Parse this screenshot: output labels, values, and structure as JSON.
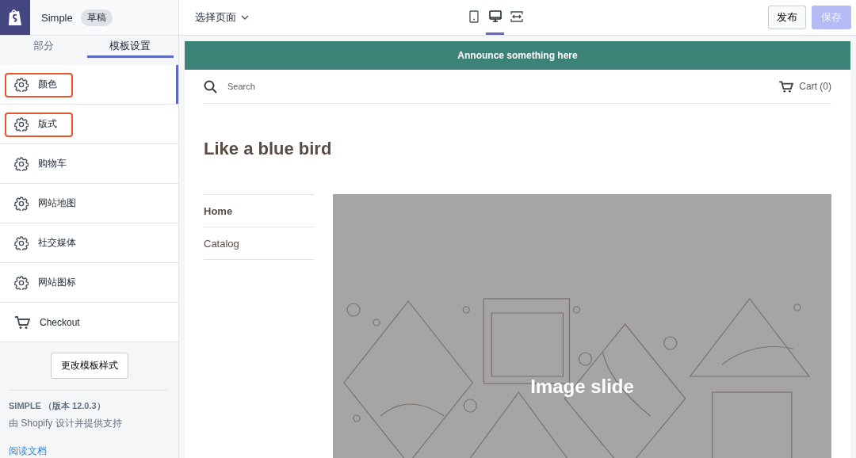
{
  "sidebar": {
    "theme_name": "Simple",
    "badge": "草稿",
    "tabs": [
      {
        "label": "部分",
        "selected": false
      },
      {
        "label": "模板设置",
        "selected": true
      }
    ],
    "items": [
      {
        "label": "颜色",
        "kind": "gear",
        "selected": true,
        "highlighted": true
      },
      {
        "label": "版式",
        "kind": "gear",
        "selected": false,
        "highlighted": true
      },
      {
        "label": "购物车",
        "kind": "gear",
        "selected": false,
        "highlighted": false
      },
      {
        "label": "网站地图",
        "kind": "gear",
        "selected": false,
        "highlighted": false
      },
      {
        "label": "社交媒体",
        "kind": "gear",
        "selected": false,
        "highlighted": false
      },
      {
        "label": "网站图标",
        "kind": "gear",
        "selected": false,
        "highlighted": false
      },
      {
        "label": "Checkout",
        "kind": "cart",
        "selected": false,
        "highlighted": false
      }
    ],
    "change_theme_button": "更改模板样式",
    "theme_info": "SIMPLE （版本 12.0.3）",
    "author": "由 Shopify 设计并提供支持",
    "docs_link": "阅读文档"
  },
  "topbar": {
    "page_select": "选择页面",
    "devices": [
      {
        "kind": "mobile",
        "selected": false
      },
      {
        "kind": "desktop",
        "selected": true
      },
      {
        "kind": "fullscreen",
        "selected": false
      }
    ],
    "publish_button": "发布",
    "save_button": {
      "label": "保存",
      "disabled": true
    }
  },
  "preview": {
    "announcement": "Announce something here",
    "search": "Search",
    "cart": "Cart (0)",
    "title": "Like a blue bird",
    "nav": [
      {
        "label": "Home",
        "selected": true
      },
      {
        "label": "Catalog",
        "selected": false
      }
    ],
    "slide_label": "Image slide"
  }
}
